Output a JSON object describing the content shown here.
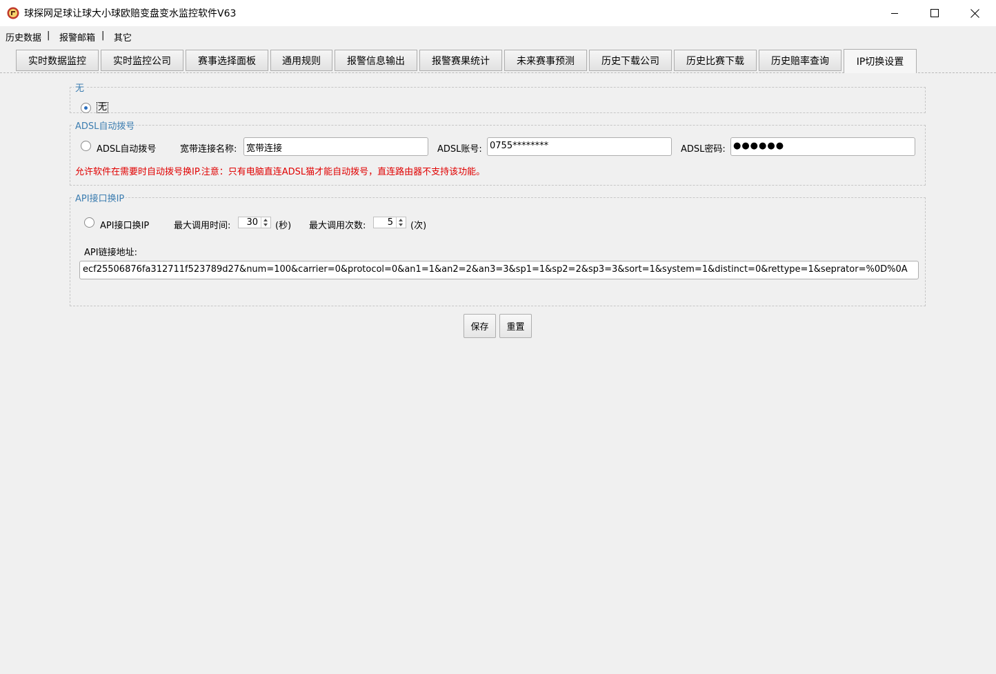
{
  "window": {
    "title": "球探网足球让球大小球欧赔变盘变水监控软件V63"
  },
  "menu": {
    "items": [
      "历史数据",
      "报警邮箱",
      "其它"
    ],
    "separator": "|"
  },
  "tabs": [
    {
      "label": "实时数据监控"
    },
    {
      "label": "实时监控公司"
    },
    {
      "label": "赛事选择面板"
    },
    {
      "label": "通用规则"
    },
    {
      "label": "报警信息输出"
    },
    {
      "label": "报警赛果统计"
    },
    {
      "label": "未来赛事预测"
    },
    {
      "label": "历史下载公司"
    },
    {
      "label": "历史比赛下载"
    },
    {
      "label": "历史赔率查询"
    },
    {
      "label": "IP切换设置",
      "active": true
    }
  ],
  "group_none": {
    "legend": "无",
    "radio_label": "无",
    "checked": true
  },
  "group_adsl": {
    "legend": "ADSL自动拨号",
    "radio_label": "ADSL自动拨号",
    "conn_name_label": "宽带连接名称:",
    "conn_name_value": "宽带连接",
    "account_label": "ADSL账号:",
    "account_value": "0755********",
    "password_label": "ADSL密码:",
    "password_value": "●●●●●●",
    "warning": "允许软件在需要时自动拨号换IP.注意：只有电脑直连ADSL猫才能自动拨号，直连路由器不支持该功能。"
  },
  "group_api": {
    "legend": "API接口换IP",
    "radio_label": "API接口换IP",
    "max_time_label": "最大调用时间:",
    "max_time_value": "30",
    "max_time_unit": "(秒)",
    "max_count_label": "最大调用次数:",
    "max_count_value": "5",
    "max_count_unit": "(次)",
    "url_label": "API链接地址:",
    "url_value": "ecf25506876fa312711f523789d27&num=100&carrier=0&protocol=0&an1=1&an2=2&an3=3&sp1=1&sp2=2&sp3=3&sort=1&system=1&distinct=0&rettype=1&seprator=%0D%0A"
  },
  "actions": {
    "save": "保存",
    "reset": "重置"
  },
  "colors": {
    "legend": "#3c7db0",
    "warning": "#e00000",
    "radio_accent": "#2a6ebd"
  }
}
